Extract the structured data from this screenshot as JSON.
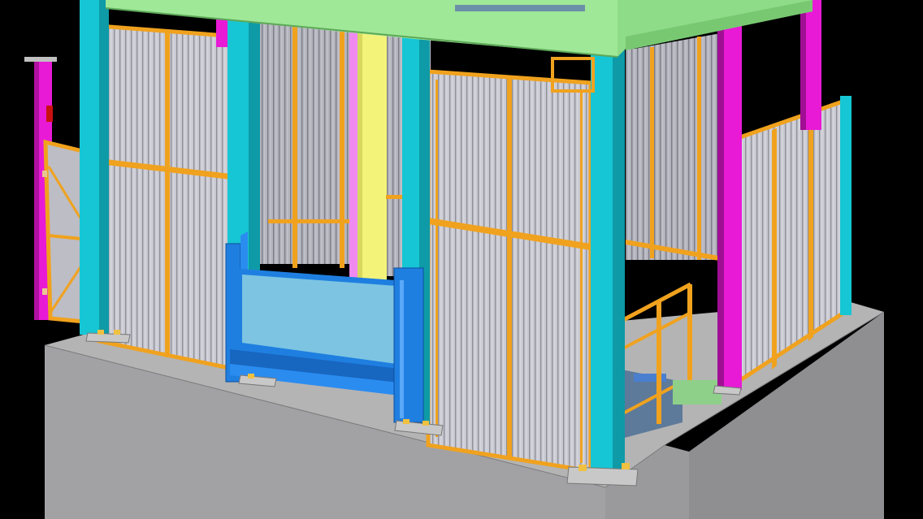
{
  "scene": {
    "kind": "3d-steel-structure-model",
    "background_color": "#000000",
    "colors": {
      "foundation_top": "#b4b4b4",
      "foundation_front": "#a2a2a4",
      "foundation_side": "#8f8f92",
      "column_cyan": "#16c6d4",
      "column_magenta": "#e81ad6",
      "column_yellow": "#f3f37a",
      "beam_green": "#9ee897",
      "frame_orange": "#f0a21e",
      "panel_grey": "#c7c7cf",
      "panel_rib": "#8e8e98",
      "gate_blue": "#1f7fe0",
      "gate_glass": "#7cc4e2",
      "base_plate": "#c8c8c8"
    },
    "components": [
      {
        "name": "concrete-foundation"
      },
      {
        "name": "steel-columns"
      },
      {
        "name": "roof-beams"
      },
      {
        "name": "corrugated-wall-panels"
      },
      {
        "name": "entry-door"
      },
      {
        "name": "blue-gate"
      },
      {
        "name": "stair-handrail"
      },
      {
        "name": "base-plates"
      }
    ]
  }
}
